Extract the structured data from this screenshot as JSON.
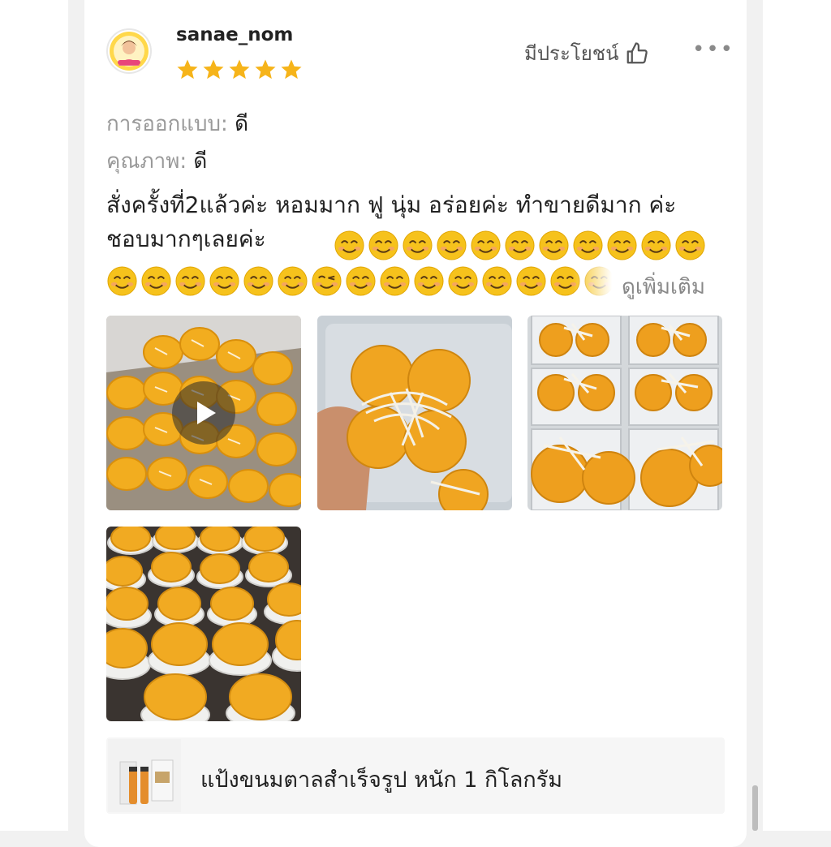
{
  "review": {
    "username": "sanae_nom",
    "rating": 5,
    "helpful_label": "มีประโยชน์",
    "more_label": "•••",
    "attributes": [
      {
        "label": "การออกแบบ:",
        "value": "ดี"
      },
      {
        "label": "คุณภาพ:",
        "value": "ดี"
      }
    ],
    "text": "สั่งครั้งที่2แล้วค่ะ หอมมาก ฟู นุ่ม อร่อยค่ะ ทำขายดีมาก ค่ะ ชอบมากๆเลยค่ะ",
    "emojis_line1": [
      "smile",
      "smile",
      "smile",
      "smile",
      "smile",
      "smile",
      "smile",
      "smile",
      "smile",
      "smile",
      "smile"
    ],
    "emojis_line2": [
      "smile",
      "smile",
      "smile",
      "smile",
      "smile",
      "smile",
      "wink",
      "smile",
      "smile",
      "smile",
      "smile",
      "smile",
      "smile",
      "smile",
      "smile"
    ],
    "see_more_label": "ดูเพิ่มเติม"
  },
  "media": [
    {
      "type": "video",
      "icon": "play-icon"
    },
    {
      "type": "photo"
    },
    {
      "type": "photo"
    },
    {
      "type": "photo"
    }
  ],
  "product": {
    "name": "แป้งขนมตาลสำเร็จรูป หนัก 1 กิโลกรัม"
  },
  "colors": {
    "star": "#f6b41a",
    "emoji": "#f6c21c",
    "card_bg": "#ffffff",
    "page_bg": "#f1f1f1"
  }
}
